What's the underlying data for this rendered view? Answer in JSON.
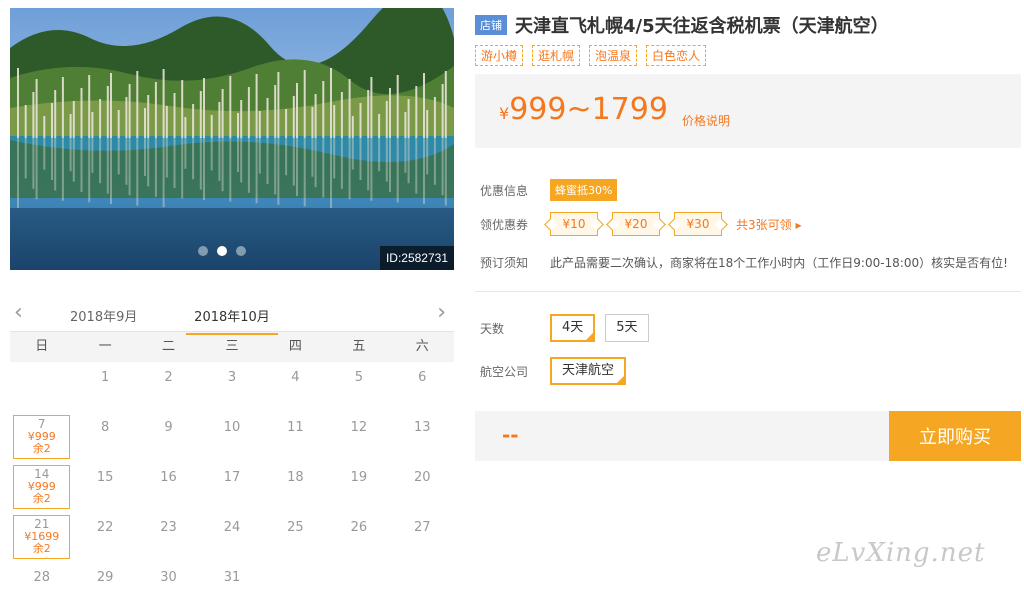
{
  "photo": {
    "id_label": "ID:2582731",
    "slides": 3,
    "active_slide": 2
  },
  "calendar": {
    "prev_month": "2018年9月",
    "current_month": "2018年10月",
    "weekdays": [
      "日",
      "一",
      "二",
      "三",
      "四",
      "五",
      "六"
    ],
    "lead_blanks": 1,
    "days": [
      {
        "d": "1"
      },
      {
        "d": "2"
      },
      {
        "d": "3"
      },
      {
        "d": "4"
      },
      {
        "d": "5"
      },
      {
        "d": "6"
      },
      {
        "d": "7",
        "price": "¥999",
        "stock": "余2"
      },
      {
        "d": "8"
      },
      {
        "d": "9"
      },
      {
        "d": "10"
      },
      {
        "d": "11"
      },
      {
        "d": "12"
      },
      {
        "d": "13"
      },
      {
        "d": "14",
        "price": "¥999",
        "stock": "余2"
      },
      {
        "d": "15"
      },
      {
        "d": "16"
      },
      {
        "d": "17"
      },
      {
        "d": "18"
      },
      {
        "d": "19"
      },
      {
        "d": "20"
      },
      {
        "d": "21",
        "price": "¥1699",
        "stock": "余2"
      },
      {
        "d": "22"
      },
      {
        "d": "23"
      },
      {
        "d": "24"
      },
      {
        "d": "25"
      },
      {
        "d": "26"
      },
      {
        "d": "27"
      },
      {
        "d": "28"
      },
      {
        "d": "29"
      },
      {
        "d": "30"
      },
      {
        "d": "31"
      }
    ]
  },
  "product": {
    "store_badge": "店铺",
    "title": "天津直飞札幌4/5天往返含税机票（天津航空）",
    "tags": [
      "游小樽",
      "逛札幌",
      "泡温泉",
      "白色恋人"
    ],
    "price_symbol": "¥",
    "price_range": "999~1799",
    "price_note": "价格说明"
  },
  "offers": {
    "discount_label": "优惠信息",
    "discount_badge": "蜂蜜抵30%",
    "coupon_label": "领优惠券",
    "coupons": [
      "¥10",
      "¥20",
      "¥30"
    ],
    "coupon_total": "共3张可领 ▸",
    "notice_label": "预订须知",
    "notice_text": "此产品需要二次确认，商家将在18个工作小时内（工作日9:00-18:00）核实是否有位!"
  },
  "options": {
    "days_label": "天数",
    "days": [
      {
        "label": "4天",
        "selected": true
      },
      {
        "label": "5天",
        "selected": false
      }
    ],
    "airline_label": "航空公司",
    "airlines": [
      {
        "label": "天津航空",
        "selected": true
      }
    ]
  },
  "buy": {
    "price_placeholder": "--",
    "button_label": "立即购买"
  },
  "watermark": "eLvXing.net",
  "colors": {
    "accent": "#f5a623",
    "price": "#f5781e",
    "badge": "#5a8fd8"
  }
}
